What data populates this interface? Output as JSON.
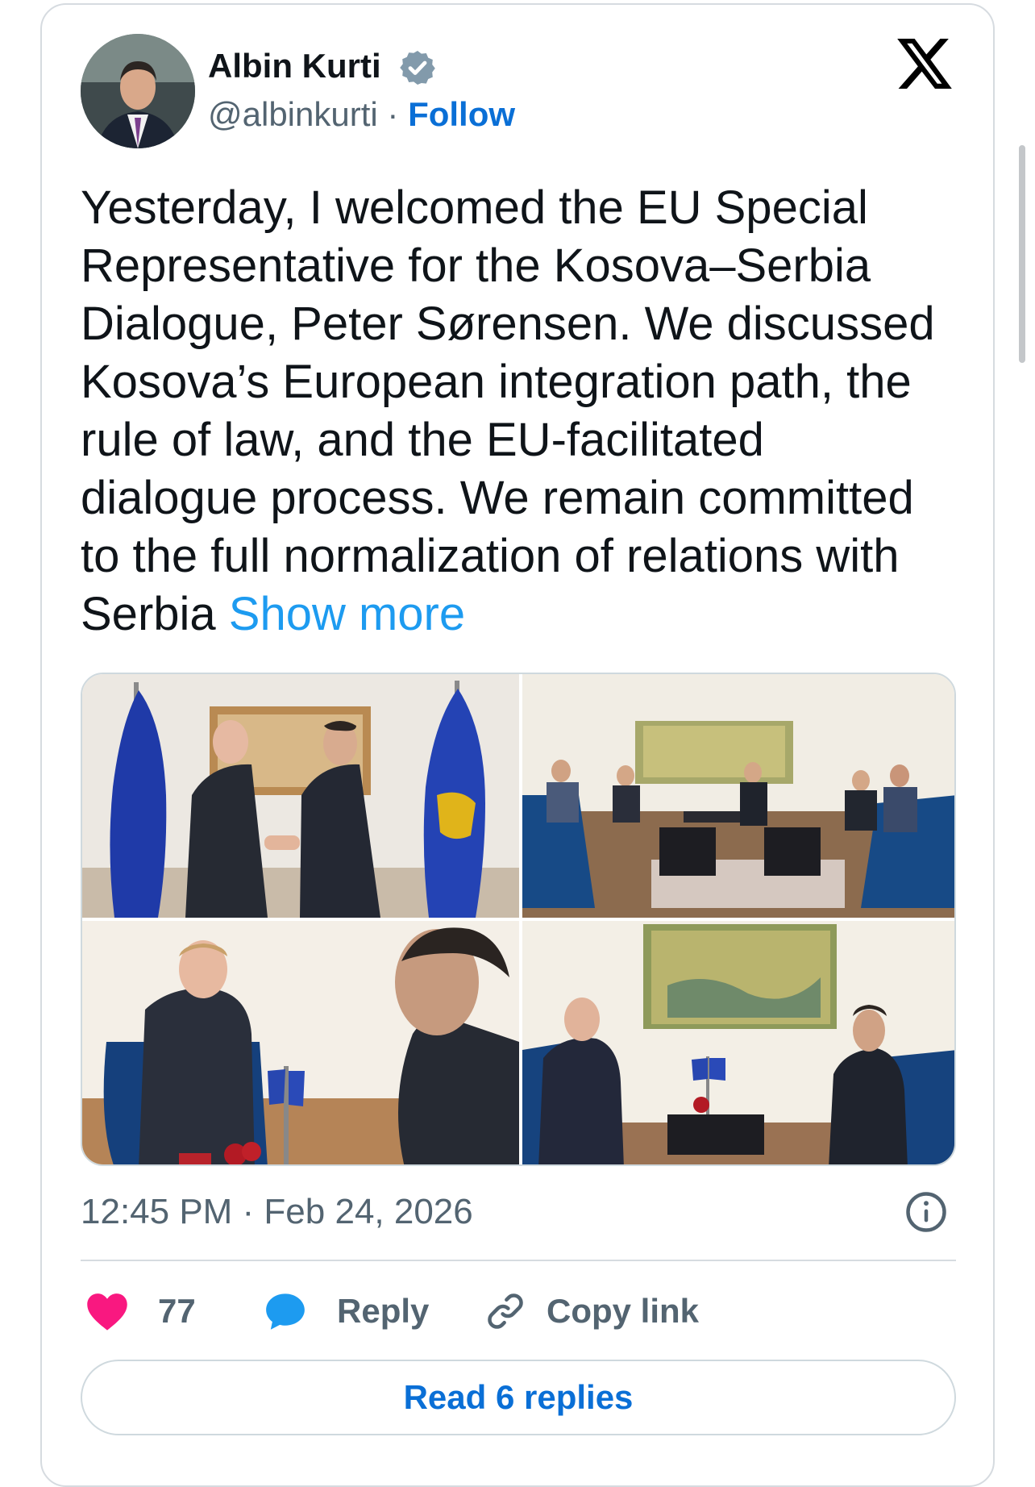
{
  "author": {
    "name": "Albin Kurti",
    "handle": "@albinkurti",
    "separator": "·",
    "follow_label": "Follow"
  },
  "tweet": {
    "text": "Yesterday, I welcomed the EU Special\nRepresentative for the Kosova–Serbia\nDialogue, Peter Sørensen. We discussed\nKosova’s European integration path, the\nrule of law, and the EU-facilitated\ndialogue process. We remain committed\nto the full normalization of relations with\nSerbia ",
    "show_more_label": "Show more",
    "timestamp": "12:45 PM · Feb 24, 2026"
  },
  "media": {
    "photos": [
      "handshake-with-flags",
      "meeting-room-delegations",
      "guest-seated-smiling",
      "meeting-seated-with-flags"
    ]
  },
  "actions": {
    "likes_count": "77",
    "reply_label": "Reply",
    "copy_link_label": "Copy link",
    "read_replies_label": "Read 6 replies"
  },
  "icons": [
    "verified-icon",
    "x-logo-icon",
    "info-icon",
    "heart-icon",
    "reply-bubble-icon",
    "link-icon"
  ],
  "colors": {
    "accent_blue": "#1d9bf0",
    "link_blue": "#0a6fd6",
    "heart": "#f91880",
    "muted": "#536471"
  }
}
